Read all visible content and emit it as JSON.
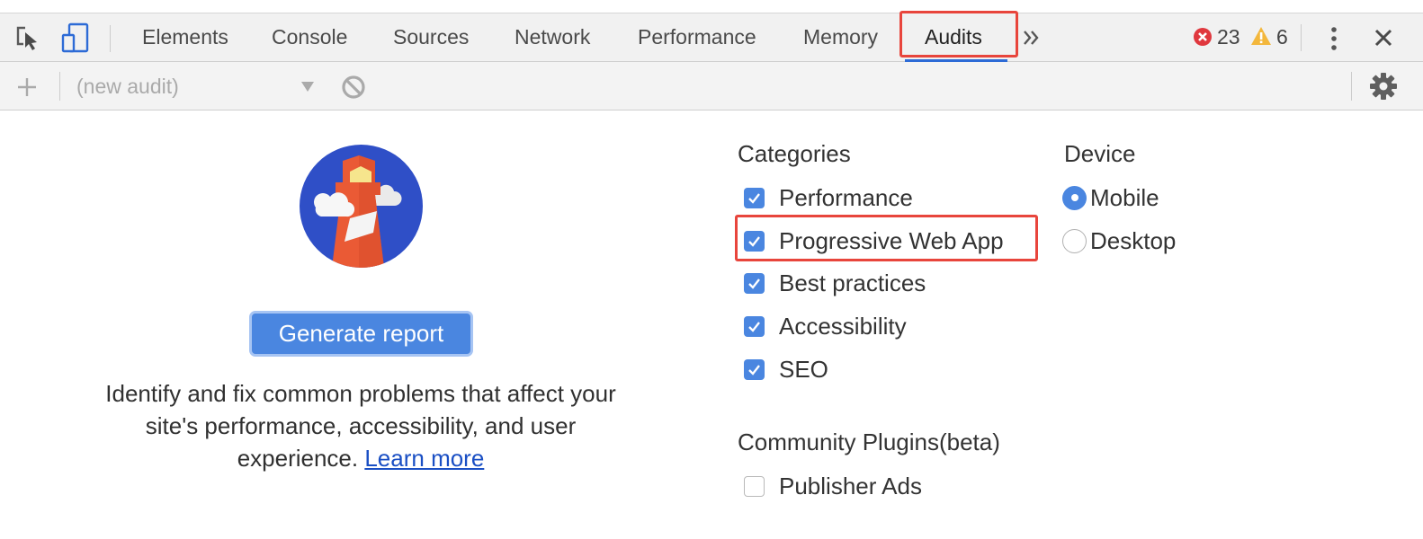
{
  "tabs": [
    {
      "label": "Elements",
      "active": false
    },
    {
      "label": "Console",
      "active": false
    },
    {
      "label": "Sources",
      "active": false
    },
    {
      "label": "Network",
      "active": false
    },
    {
      "label": "Performance",
      "active": false
    },
    {
      "label": "Memory",
      "active": false
    },
    {
      "label": "Audits",
      "active": true
    }
  ],
  "status": {
    "error_count": "23",
    "warning_count": "6"
  },
  "toolbar": {
    "audit_select_value": "(new audit)"
  },
  "main": {
    "generate_button": "Generate report",
    "description": "Identify and fix common problems that affect your site's performance, accessibility, and user experience.",
    "learn_more": "Learn more"
  },
  "categories": {
    "title": "Categories",
    "items": [
      {
        "label": "Performance",
        "checked": true
      },
      {
        "label": "Progressive Web App",
        "checked": true
      },
      {
        "label": "Best practices",
        "checked": true
      },
      {
        "label": "Accessibility",
        "checked": true
      },
      {
        "label": "SEO",
        "checked": true
      }
    ]
  },
  "device": {
    "title": "Device",
    "options": [
      {
        "label": "Mobile",
        "selected": true
      },
      {
        "label": "Desktop",
        "selected": false
      }
    ]
  },
  "plugins": {
    "title": "Community Plugins(beta)",
    "items": [
      {
        "label": "Publisher Ads",
        "checked": false
      }
    ]
  },
  "colors": {
    "accent": "#4a86e0",
    "highlight": "#e8453c",
    "error": "#e0383e",
    "warning": "#f3b73c"
  }
}
